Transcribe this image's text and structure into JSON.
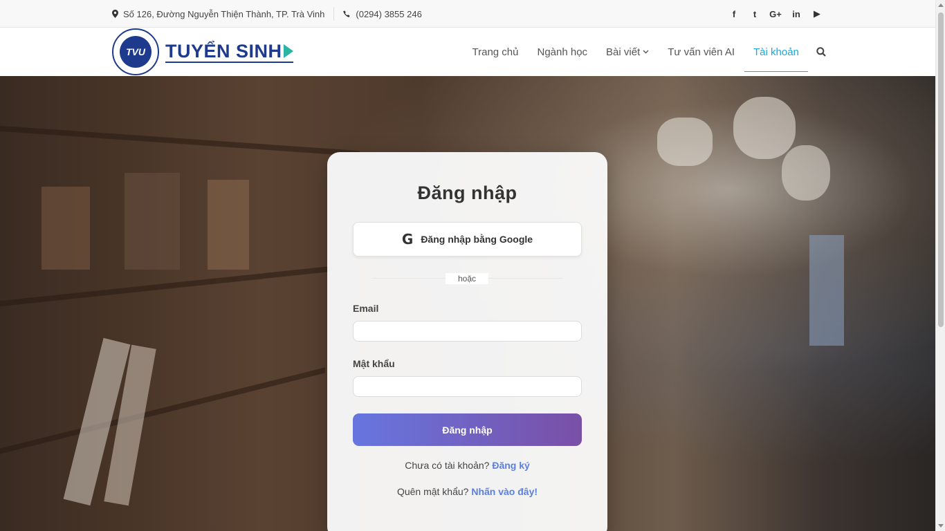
{
  "topbar": {
    "address": "Số 126, Đường Nguyễn Thiện Thành, TP. Trà Vinh",
    "phone": "(0294) 3855 246",
    "social": [
      "f",
      "t",
      "G+",
      "in",
      "▶"
    ]
  },
  "header": {
    "logo_text": "TUYỂN SINH",
    "seal_text": "TVU",
    "nav": {
      "home": "Trang chủ",
      "majors": "Ngành học",
      "posts": "Bài viết",
      "ai_advisor": "Tư vấn viên AI",
      "account": "Tài khoản"
    }
  },
  "login": {
    "title": "Đăng nhập",
    "google_label": "Đăng nhập bằng Google",
    "divider_label": "hoặc",
    "email_label": "Email",
    "email_value": "",
    "password_label": "Mật khẩu",
    "password_value": "",
    "submit_label": "Đăng nhập",
    "no_account_text": "Chưa có tài khoản?",
    "register_link": "Đăng ký",
    "forgot_text": "Quên mật khẩu?",
    "forgot_link": "Nhấn vào đây!"
  },
  "colors": {
    "accent": "#1ba8d8",
    "brand": "#1d3a8c",
    "button_start": "#6776df",
    "button_end": "#7a4fa6",
    "link": "#5b7fe0"
  }
}
